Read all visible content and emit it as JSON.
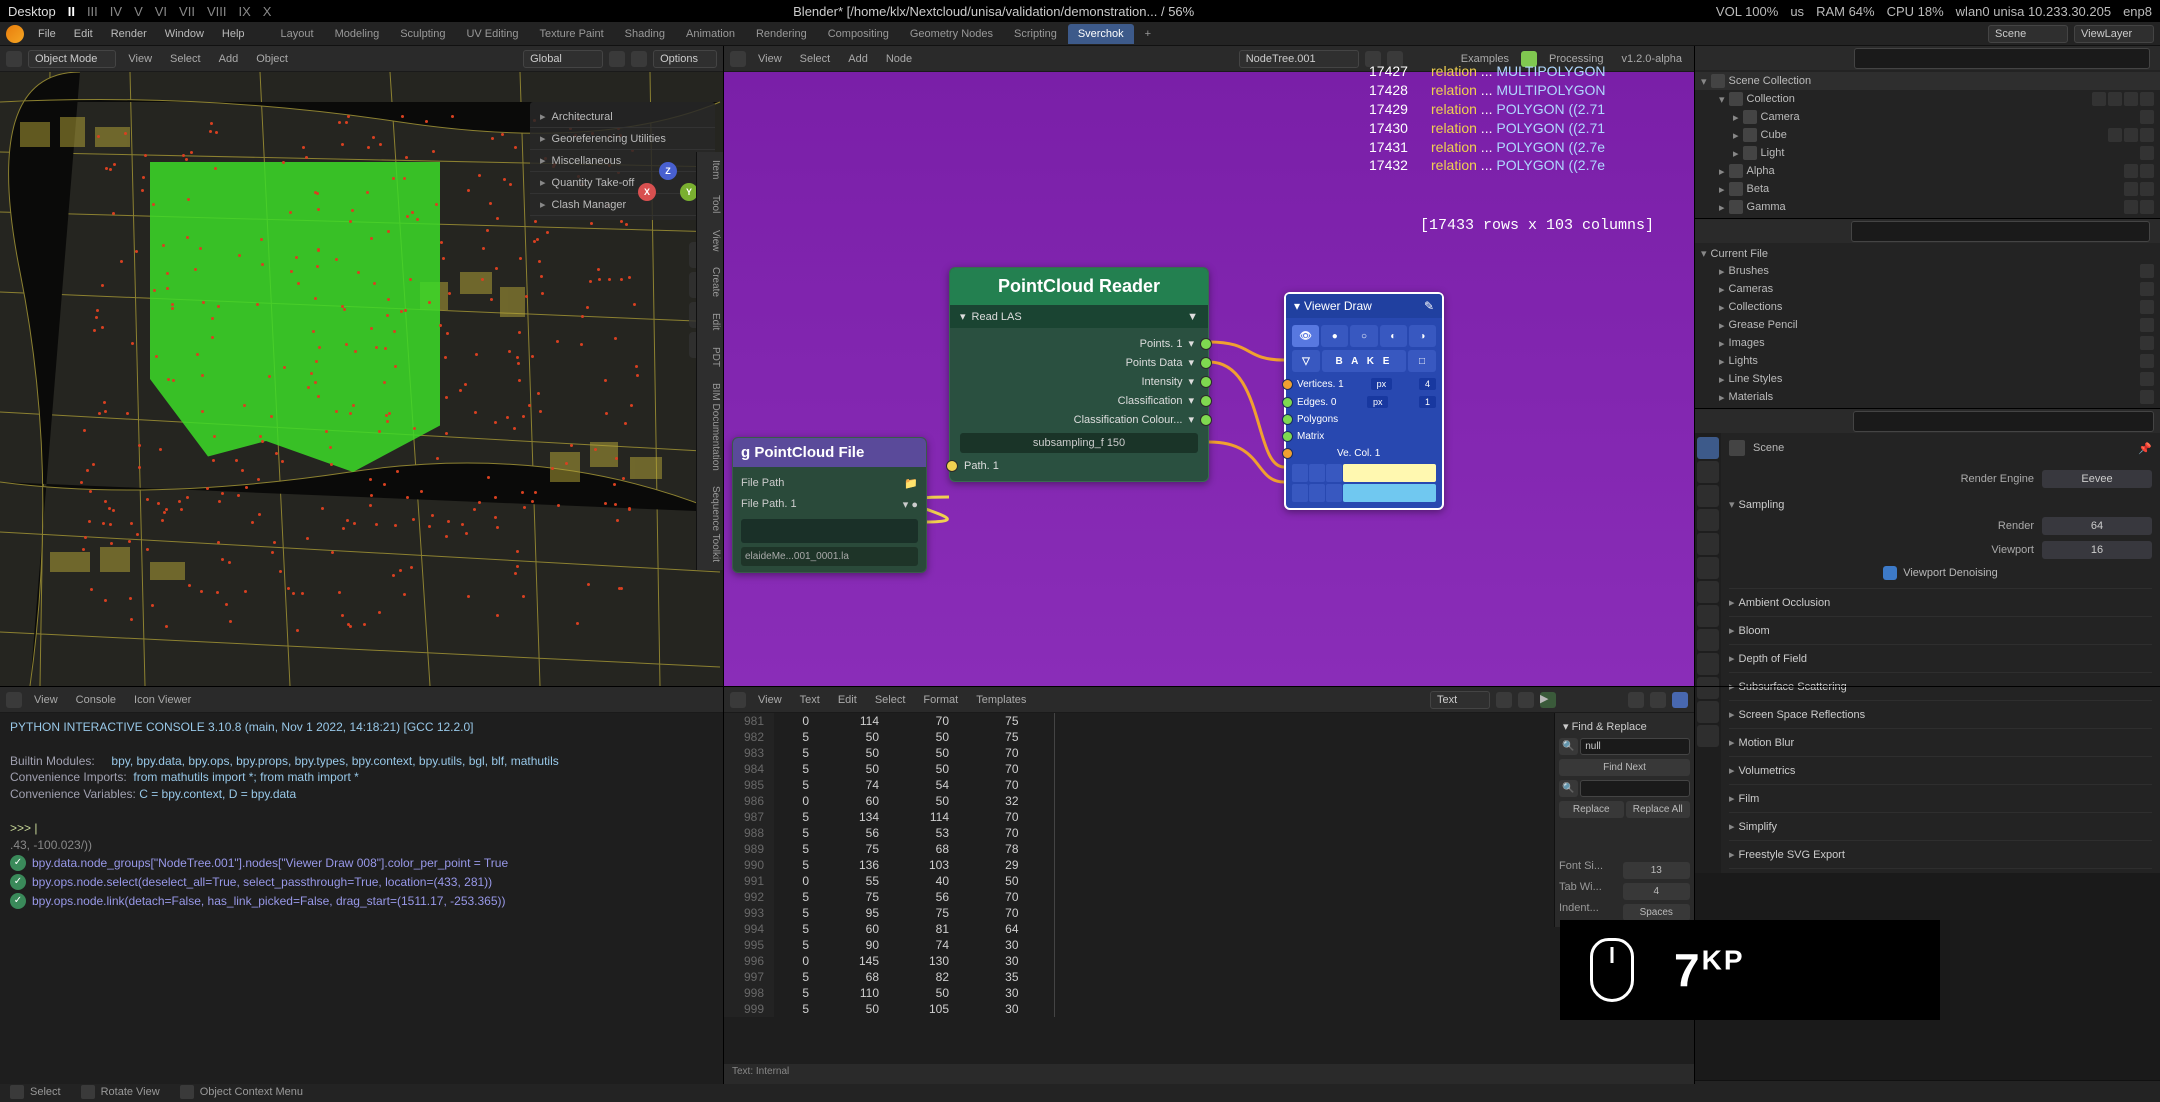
{
  "sysbar": {
    "desktop": "Desktop",
    "workspaces": [
      "II",
      "III",
      "IV",
      "V",
      "VI",
      "VII",
      "VIII",
      "IX",
      "X"
    ],
    "active_ws": 0,
    "title": "Blender* [/home/klx/Nextcloud/unisa/validation/demonstration...",
    "pct": "/ 56%",
    "vol": "VOL 100%",
    "locale": "us",
    "ram": "RAM 64%",
    "cpu": "CPU 18%",
    "net": "wlan0 unisa 10.233.30.205",
    "iface": "enp8"
  },
  "menu": {
    "items": [
      "File",
      "Edit",
      "Render",
      "Window",
      "Help"
    ],
    "tabs": [
      "Layout",
      "Modeling",
      "Sculpting",
      "UV Editing",
      "Texture Paint",
      "Shading",
      "Animation",
      "Rendering",
      "Compositing",
      "Geometry Nodes",
      "Scripting",
      "Sverchok"
    ],
    "active_tab": 11,
    "scene": "Scene",
    "viewlayer": "ViewLayer"
  },
  "viewport": {
    "mode": "Object Mode",
    "menus": [
      "View",
      "Select",
      "Add",
      "Object"
    ],
    "orient": "Global",
    "options": "Options",
    "overlay": {
      "items": [
        "Architectural",
        "Georeferencing Utilities",
        "Miscellaneous",
        "Quantity Take-off",
        "Clash Manager"
      ]
    },
    "side_tabs": [
      "Item",
      "Tool",
      "View",
      "Create",
      "Edit",
      "PDT",
      "BIM Documentation",
      "Sequence Toolkit"
    ]
  },
  "nodeed": {
    "menus": [
      "View",
      "Select",
      "Add",
      "Node"
    ],
    "treename": "NodeTree.001",
    "examples": "Examples",
    "processing": "Processing",
    "version": "v1.2.0-alpha",
    "log": [
      {
        "i": "17427",
        "r": "relation",
        "g": "MULTIPOLYGON"
      },
      {
        "i": "17428",
        "r": "relation",
        "g": "MULTIPOLYGON"
      },
      {
        "i": "17429",
        "r": "relation",
        "g": "POLYGON ((2.71"
      },
      {
        "i": "17430",
        "r": "relation",
        "g": "POLYGON ((2.71"
      },
      {
        "i": "17431",
        "r": "relation",
        "g": "POLYGON ((2.7e"
      },
      {
        "i": "17432",
        "r": "relation",
        "g": "POLYGON ((2.7e"
      }
    ],
    "summary": "[17433 rows x 103 columns]",
    "file_node": {
      "title": "g PointCloud  File",
      "filepath_lbl": "File Path",
      "filepath_socket": "File Path. 1",
      "filename": "elaideMe...001_0001.la"
    },
    "pc_node": {
      "title": "PointCloud Reader",
      "sub": "Read LAS",
      "outs": [
        "Points. 1",
        "Points Data",
        "Intensity",
        "Classification",
        "Classification Colour..."
      ],
      "slider": "subsampling_f  150",
      "in": "Path. 1"
    },
    "vd_node": {
      "title": "Viewer Draw",
      "bake": "B A K E",
      "ins": [
        {
          "lbl": "Vertices. 1",
          "px": "px",
          "v": "4"
        },
        {
          "lbl": "Edges. 0",
          "px": "px",
          "v": "1"
        },
        {
          "lbl": "Polygons"
        },
        {
          "lbl": "Matrix"
        },
        {
          "lbl": "Ve. Col. 1"
        }
      ]
    }
  },
  "outliner": {
    "title": "Scene Collection",
    "items": [
      {
        "lvl": 1,
        "name": "Collection",
        "open": true,
        "btns": 4
      },
      {
        "lvl": 2,
        "name": "Camera",
        "open": false,
        "btns": 1
      },
      {
        "lvl": 2,
        "name": "Cube",
        "open": false,
        "btns": 3
      },
      {
        "lvl": 2,
        "name": "Light",
        "open": false,
        "btns": 1
      },
      {
        "lvl": 1,
        "name": "Alpha",
        "open": false,
        "btns": 2
      },
      {
        "lvl": 1,
        "name": "Beta",
        "open": false,
        "btns": 2
      },
      {
        "lvl": 1,
        "name": "Gamma",
        "open": false,
        "btns": 2
      }
    ]
  },
  "props_top": {
    "current_file": "Current File",
    "items": [
      "Brushes",
      "Cameras",
      "Collections",
      "Grease Pencil",
      "Images",
      "Lights",
      "Line Styles",
      "Materials"
    ]
  },
  "props": {
    "scene": "Scene",
    "render_engine_lbl": "Render Engine",
    "render_engine": "Eevee",
    "sampling": "Sampling",
    "render_lbl": "Render",
    "render_val": "64",
    "viewport_lbl": "Viewport",
    "viewport_val": "16",
    "denoise": "Viewport Denoising",
    "sections": [
      "Ambient Occlusion",
      "Bloom",
      "Depth of Field",
      "Subsurface Scattering",
      "Screen Space Reflections",
      "Motion Blur",
      "Volumetrics",
      "Film",
      "Simplify",
      "Freestyle SVG Export"
    ]
  },
  "console": {
    "menus": [
      "View",
      "Console",
      "Icon Viewer"
    ],
    "header": "PYTHON INTERACTIVE CONSOLE 3.10.8 (main, Nov  1 2022, 14:18:21) [GCC 12.2.0]",
    "builtin_lbl": "Builtin Modules:",
    "builtin": "bpy, bpy.data, bpy.ops, bpy.props, bpy.types, bpy.context, bpy.utils, bgl, blf, mathutils",
    "conv_imp_lbl": "Convenience Imports:",
    "conv_imp": "from mathutils import *; from math import *",
    "conv_var_lbl": "Convenience Variables:",
    "conv_var": "C = bpy.context, D = bpy.data",
    "prompt": ">>> |",
    "trail": ".43, -100.023/))",
    "lines": [
      "bpy.data.node_groups[\"NodeTree.001\"].nodes[\"Viewer Draw 008\"].color_per_point = True",
      "bpy.ops.node.select(deselect_all=True, select_passthrough=True, location=(433, 281))",
      "bpy.ops.node.link(detach=False, has_link_picked=False, drag_start=(1511.17, -253.365))"
    ]
  },
  "texted": {
    "menus": [
      "View",
      "Text",
      "Edit",
      "Select",
      "Format",
      "Templates"
    ],
    "docname": "Text",
    "rows": [
      {
        "ln": "981",
        "c": [
          "0",
          "114",
          "70",
          "75"
        ]
      },
      {
        "ln": "982",
        "c": [
          "5",
          "50",
          "50",
          "75"
        ]
      },
      {
        "ln": "983",
        "c": [
          "5",
          "50",
          "50",
          "70"
        ]
      },
      {
        "ln": "984",
        "c": [
          "5",
          "50",
          "50",
          "70"
        ]
      },
      {
        "ln": "985",
        "c": [
          "5",
          "74",
          "54",
          "70"
        ]
      },
      {
        "ln": "986",
        "c": [
          "0",
          "60",
          "50",
          "32"
        ]
      },
      {
        "ln": "987",
        "c": [
          "5",
          "134",
          "114",
          "70"
        ]
      },
      {
        "ln": "988",
        "c": [
          "5",
          "56",
          "53",
          "70"
        ]
      },
      {
        "ln": "989",
        "c": [
          "5",
          "75",
          "68",
          "78"
        ]
      },
      {
        "ln": "990",
        "c": [
          "5",
          "136",
          "103",
          "29"
        ]
      },
      {
        "ln": "991",
        "c": [
          "0",
          "55",
          "40",
          "50"
        ]
      },
      {
        "ln": "992",
        "c": [
          "5",
          "75",
          "56",
          "70"
        ]
      },
      {
        "ln": "993",
        "c": [
          "5",
          "95",
          "75",
          "70"
        ]
      },
      {
        "ln": "994",
        "c": [
          "5",
          "60",
          "81",
          "64"
        ]
      },
      {
        "ln": "995",
        "c": [
          "5",
          "90",
          "74",
          "30"
        ]
      },
      {
        "ln": "996",
        "c": [
          "0",
          "145",
          "130",
          "30"
        ]
      },
      {
        "ln": "997",
        "c": [
          "5",
          "68",
          "82",
          "35"
        ]
      },
      {
        "ln": "998",
        "c": [
          "5",
          "110",
          "50",
          "30"
        ]
      },
      {
        "ln": "999",
        "c": [
          "5",
          "50",
          "105",
          "30"
        ]
      }
    ],
    "find": {
      "title": "Find & Replace",
      "placeholder": "null",
      "findnext": "Find Next",
      "replace": "Replace",
      "replaceall": "Replace All",
      "fontsize_lbl": "Font Si...",
      "fontsize": "13",
      "tabw_lbl": "Tab Wi...",
      "tabw": "4",
      "indent_lbl": "Indent...",
      "indent": "Spaces"
    },
    "footer": "Text: Internal"
  },
  "statusbar": {
    "select": "Select",
    "rotate": "Rotate View",
    "ctx": "Object Context Menu"
  },
  "keyoverlay": {
    "key": "7",
    "mod": "KP"
  }
}
